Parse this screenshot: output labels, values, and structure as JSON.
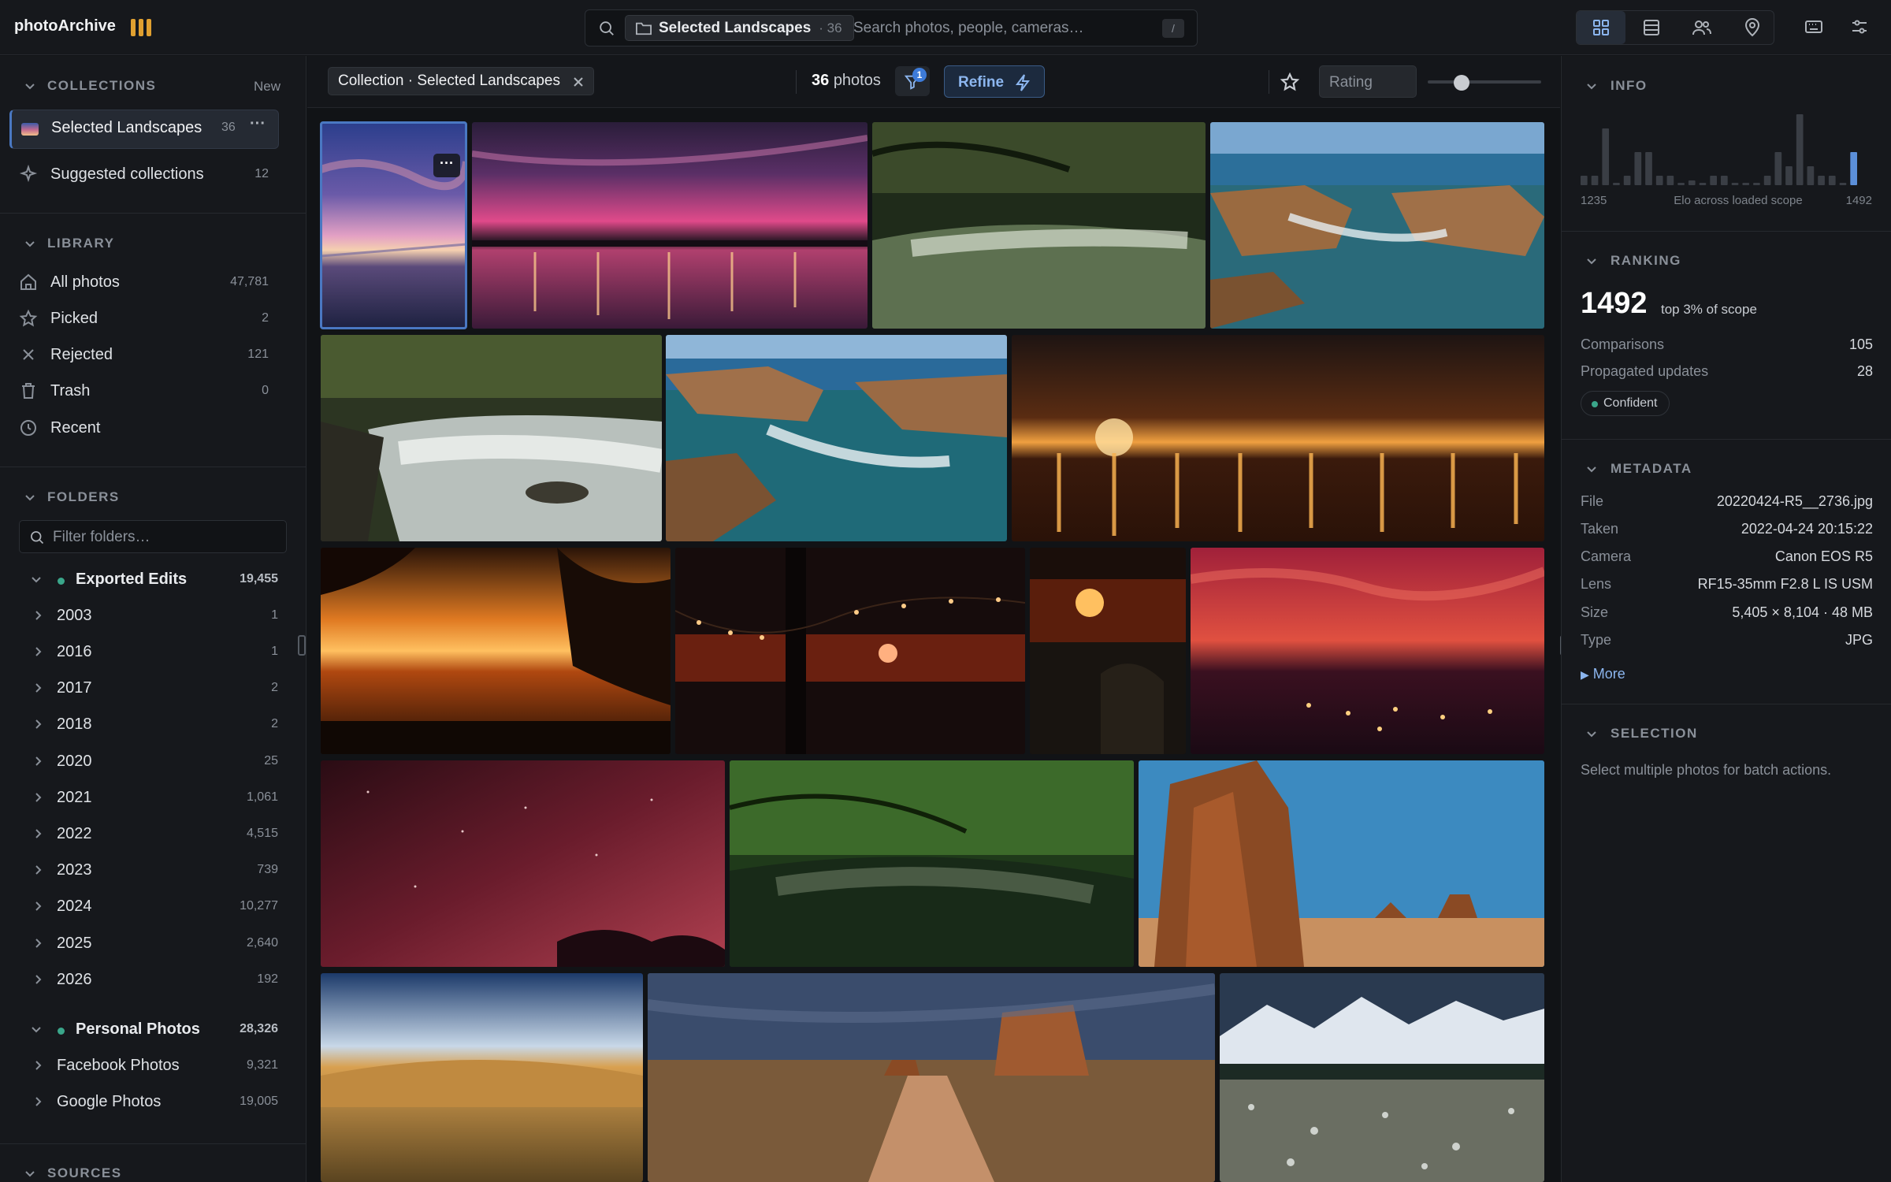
{
  "app": {
    "name": "photoArchive",
    "brand_color": "#e0a030"
  },
  "search": {
    "scope_label": "Selected Landscapes",
    "scope_count": "· 36",
    "placeholder": "Search photos, people, cameras…",
    "shortcut": "/"
  },
  "view_modes": [
    {
      "icon": "grid-icon",
      "active": true
    },
    {
      "icon": "table-icon",
      "active": false
    },
    {
      "icon": "people-icon",
      "active": false
    },
    {
      "icon": "map-pin-icon",
      "active": false
    }
  ],
  "top_icons": [
    "keyboard-icon",
    "settings-sliders-icon"
  ],
  "sidebar": {
    "collections": {
      "title": "COLLECTIONS",
      "new_label": "New",
      "items": [
        {
          "label": "Selected Landscapes",
          "count": "36",
          "active": true
        },
        {
          "label": "Suggested collections",
          "count": "12",
          "active": false
        }
      ]
    },
    "library": {
      "title": "LIBRARY",
      "items": [
        {
          "label": "All photos",
          "count": "47,781",
          "icon": "home-icon"
        },
        {
          "label": "Picked",
          "count": "2",
          "icon": "star-icon"
        },
        {
          "label": "Rejected",
          "count": "121",
          "icon": "x-icon"
        },
        {
          "label": "Trash",
          "count": "0",
          "icon": "trash-icon"
        },
        {
          "label": "Recent",
          "count": "",
          "icon": "clock-icon"
        }
      ]
    },
    "folders": {
      "title": "FOLDERS",
      "filter_placeholder": "Filter folders…",
      "groups": [
        {
          "label": "Exported Edits",
          "count": "19,455",
          "children": [
            {
              "label": "2003",
              "count": "1"
            },
            {
              "label": "2016",
              "count": "1"
            },
            {
              "label": "2017",
              "count": "2"
            },
            {
              "label": "2018",
              "count": "2"
            },
            {
              "label": "2020",
              "count": "25"
            },
            {
              "label": "2021",
              "count": "1,061"
            },
            {
              "label": "2022",
              "count": "4,515"
            },
            {
              "label": "2023",
              "count": "739"
            },
            {
              "label": "2024",
              "count": "10,277"
            },
            {
              "label": "2025",
              "count": "2,640"
            },
            {
              "label": "2026",
              "count": "192"
            }
          ]
        },
        {
          "label": "Personal Photos",
          "count": "28,326",
          "children": [
            {
              "label": "Facebook Photos",
              "count": "9,321"
            },
            {
              "label": "Google Photos",
              "count": "19,005"
            }
          ]
        }
      ]
    },
    "sources": {
      "title": "SOURCES"
    }
  },
  "toolbar": {
    "scope_tag": "Collection · Selected Landscapes",
    "photo_count": "36",
    "photo_count_suffix": "photos",
    "filter_badge": "1",
    "refine_label": "Refine",
    "rating_placeholder": "Rating",
    "thumb_size_level": 0.3
  },
  "photos": [
    {
      "subject": "purple sunset lake tall",
      "selected": true
    },
    {
      "subject": "magenta sunset lake"
    },
    {
      "subject": "forest river flow"
    },
    {
      "subject": "rocky coast waves"
    },
    {
      "subject": "waterfall forest"
    },
    {
      "subject": "rocky coast waves 2"
    },
    {
      "subject": "night city lights reflection"
    },
    {
      "subject": "orange sunset trees lake"
    },
    {
      "subject": "palm tree string lights sunset"
    },
    {
      "subject": "sun over sea"
    },
    {
      "subject": "red sky city night"
    },
    {
      "subject": "red starry sky"
    },
    {
      "subject": "green river forest"
    },
    {
      "subject": "desert butte blue sky"
    },
    {
      "subject": "golden hills"
    },
    {
      "subject": "desert road monument"
    },
    {
      "subject": "snowy mountains plain"
    }
  ],
  "info": {
    "title": "INFO",
    "histogram": [
      2,
      2,
      12,
      0,
      2,
      7,
      7,
      2,
      2,
      0,
      1,
      0,
      2,
      2,
      0,
      0,
      0,
      2,
      7,
      4,
      15,
      4,
      2,
      2,
      0,
      7
    ],
    "histogram_highlight_index": 25,
    "min_label": "1235",
    "axis_label": "Elo across loaded scope",
    "max_label": "1492"
  },
  "ranking": {
    "title": "RANKING",
    "score": "1492",
    "subtitle": "top 3% of scope",
    "rows": [
      {
        "k": "Comparisons",
        "v": "105"
      },
      {
        "k": "Propagated updates",
        "v": "28"
      }
    ],
    "confidence": "Confident"
  },
  "metadata": {
    "title": "METADATA",
    "rows": [
      {
        "k": "File",
        "v": "20220424-R5__2736.jpg"
      },
      {
        "k": "Taken",
        "v": "2022-04-24 20:15:22"
      },
      {
        "k": "Camera",
        "v": "Canon EOS R5"
      },
      {
        "k": "Lens",
        "v": "RF15-35mm F2.8 L IS USM"
      },
      {
        "k": "Size",
        "v": "5,405 × 8,104 · 48 MB"
      },
      {
        "k": "Type",
        "v": "JPG"
      }
    ],
    "more_label": "More"
  },
  "selection": {
    "title": "SELECTION",
    "text": "Select multiple photos for batch actions."
  }
}
